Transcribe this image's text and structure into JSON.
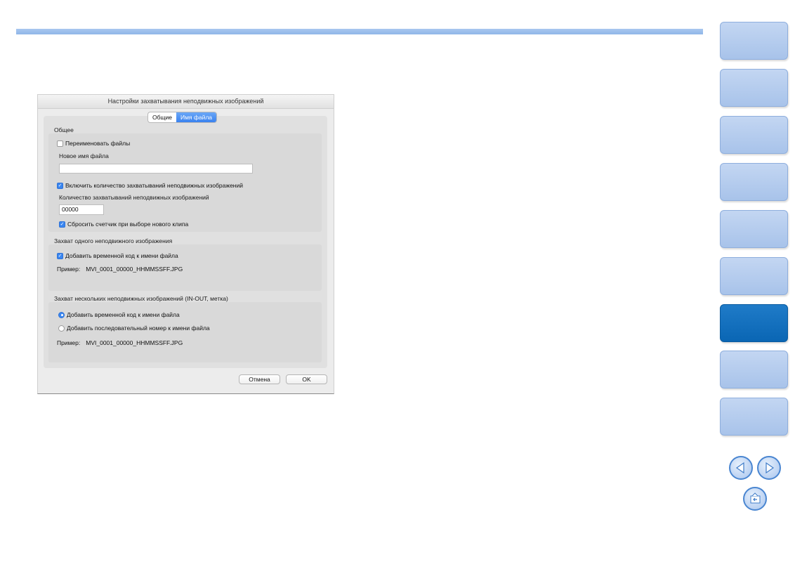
{
  "dialog": {
    "title": "Настройки захватывания неподвижных изображений",
    "tabs": [
      {
        "label": "Общие",
        "selected": false
      },
      {
        "label": "Имя файла",
        "selected": true
      }
    ],
    "general": {
      "heading": "Общее",
      "rename_label": "Переименовать файлы",
      "rename_checked": false,
      "new_name_label": "Новое имя файла",
      "new_name_value": "",
      "include_count_label": "Включить количество захватываний неподвижных изображений",
      "include_count_checked": true,
      "count_label": "Количество захватываний неподвижных изображений",
      "count_value": "00000",
      "reset_label": "Сбросить счетчик при выборе нового клипа",
      "reset_checked": true
    },
    "single": {
      "heading": "Захват одного неподвижного изображения",
      "timecode_label": "Добавить временной код к имени файла",
      "timecode_checked": true,
      "example_label": "Пример:",
      "example_value": "MVI_0001_00000_HHMMSSFF.JPG"
    },
    "multiple": {
      "heading": "Захват нескольких неподвижных изображений (IN-OUT, метка)",
      "option_timecode": "Добавить временной код к имени файла",
      "option_sequence": "Добавить последовательный номер к имени файла",
      "selected_option": "timecode",
      "example_label": "Пример:",
      "example_value": "MVI_0001_00000_HHMMSSFF.JPG"
    },
    "buttons": {
      "cancel": "Отмена",
      "ok": "OK"
    }
  },
  "side_nav": {
    "tab_count": 9,
    "active_tab_index": 6,
    "tab_color": "#b7cdef",
    "active_tab_color": "#0a6ab8"
  },
  "page_nav_icons": [
    "previous-page-icon",
    "next-page-icon",
    "return-icon"
  ]
}
